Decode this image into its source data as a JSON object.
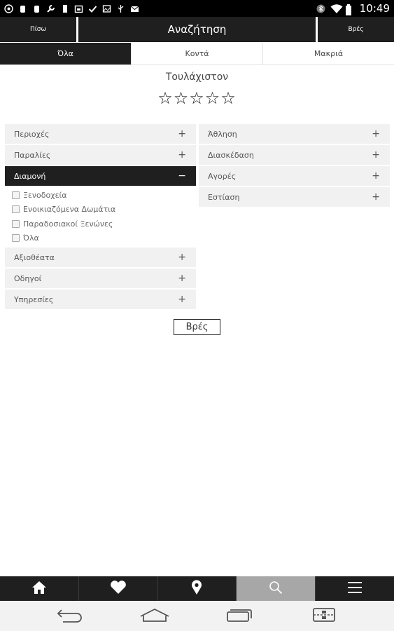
{
  "status_bar": {
    "time": "10:49",
    "left_icons": [
      "whatsapp-icon",
      "usb-debug-icon",
      "usb-debug-icon",
      "wrench-icon",
      "battery-full-icon",
      "calendar-icon",
      "check-icon",
      "image-icon",
      "usb-icon",
      "mail-icon"
    ],
    "right_icons": [
      "bluetooth-icon",
      "wifi-icon",
      "battery-icon"
    ]
  },
  "action_bar": {
    "back_label": "Πίσω",
    "title": "Αναζήτηση",
    "find_label": "Βρές"
  },
  "tabs": [
    {
      "label": "Όλα",
      "active": true
    },
    {
      "label": "Κοντά",
      "active": false
    },
    {
      "label": "Μακριά",
      "active": false
    }
  ],
  "rating": {
    "label": "Τουλάχιστον",
    "stars": "☆☆☆☆☆",
    "value": 0,
    "max": 5
  },
  "left_column": [
    {
      "label": "Περιοχές",
      "toggle": "+"
    },
    {
      "label": "Παραλίες",
      "toggle": "+"
    },
    {
      "label": "Διαμονή",
      "toggle": "−",
      "open": true,
      "subitems": [
        "Ξενοδοχεία",
        "Ενοικιαζόμενα Δωμάτια",
        "Παραδοσιακοί Ξενώνες",
        "Όλα"
      ]
    },
    {
      "label": "Αξιοθέατα",
      "toggle": "+"
    },
    {
      "label": "Οδηγοί",
      "toggle": "+"
    },
    {
      "label": "Υπηρεσίες",
      "toggle": "+"
    }
  ],
  "right_column": [
    {
      "label": "Άθληση",
      "toggle": "+"
    },
    {
      "label": "Διασκέδαση",
      "toggle": "+"
    },
    {
      "label": "Αγορές",
      "toggle": "+"
    },
    {
      "label": "Εστίαση",
      "toggle": "+"
    }
  ],
  "find_button": "Βρές",
  "bottom_nav": [
    "home-icon",
    "heart-icon",
    "map-pin-icon",
    "search-icon",
    "menu-icon"
  ],
  "bottom_nav_active": "search-icon",
  "system_nav": [
    "back-icon",
    "home-outline-icon",
    "recents-icon",
    "screenshot-icon"
  ],
  "colors": {
    "dark": "#1f1f1f",
    "active_tab": "#a7a7a7",
    "row_bg": "#f1f1f1"
  }
}
